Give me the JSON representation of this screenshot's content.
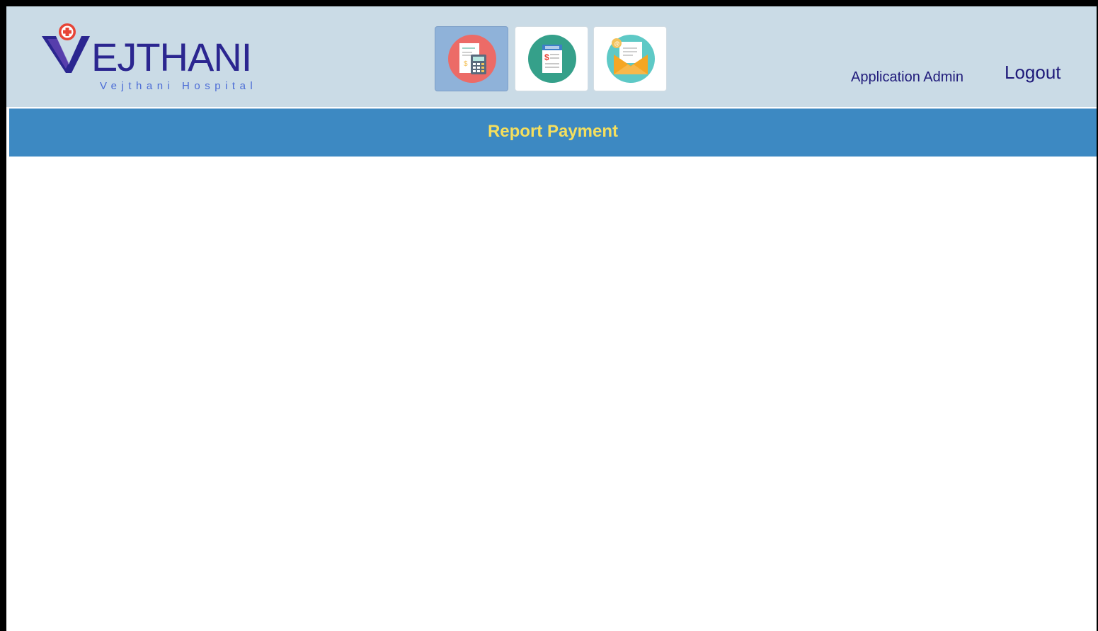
{
  "header": {
    "logo": {
      "name": "VEJTHANI",
      "letters_after_mark": "EJTHANI",
      "subtitle": "Vejthani Hospital"
    },
    "toolbar": {
      "buttons": [
        {
          "icon": "calculator-receipt-icon",
          "active": true
        },
        {
          "icon": "invoice-document-icon",
          "active": false
        },
        {
          "icon": "email-envelope-icon",
          "active": false
        }
      ]
    },
    "user_name": "Application Admin",
    "logout_label": "Logout"
  },
  "page_title": "Report Payment",
  "colors": {
    "header_bg": "#cadbe6",
    "title_bar_bg": "#3d89c2",
    "title_text": "#f5df5e",
    "brand_text": "#2b2690",
    "link_text": "#1f1a7a"
  }
}
